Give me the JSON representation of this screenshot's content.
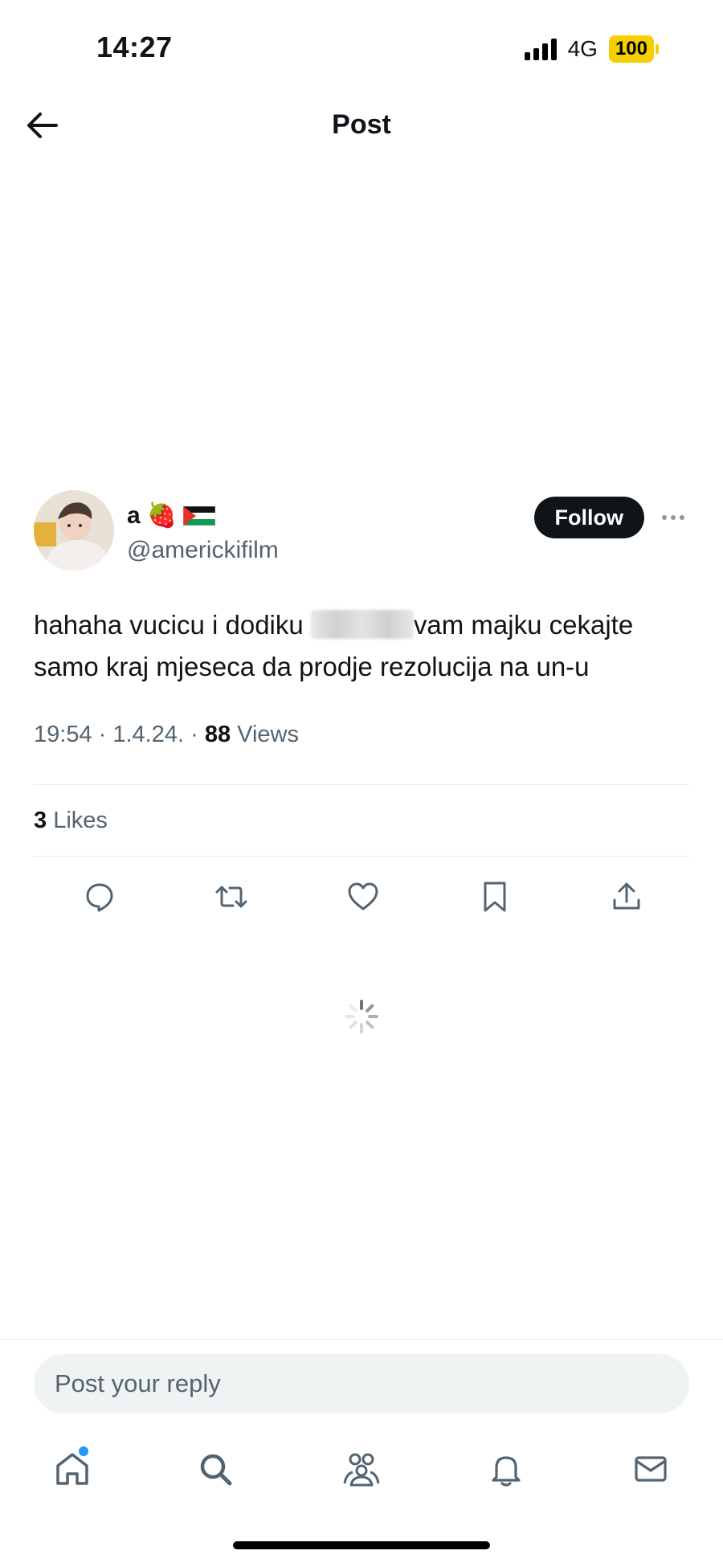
{
  "status_bar": {
    "time": "14:27",
    "network": "4G",
    "battery": "100"
  },
  "header": {
    "title": "Post"
  },
  "tweet": {
    "author_name": "a",
    "author_emojis": [
      "🍓"
    ],
    "handle": "@americkifilm",
    "follow_label": "Follow",
    "text_part1": "hahaha vucicu i dodiku ",
    "text_part2": "vam majku cekajte samo kraj mjeseca da prodje rezolucija na un-u",
    "time": "19:54",
    "date": "1.4.24.",
    "views_count": "88",
    "views_label": "Views",
    "likes_count": "3",
    "likes_label": "Likes"
  },
  "actions": [
    "reply-icon",
    "retweet-icon",
    "like-icon",
    "bookmark-icon",
    "share-icon"
  ],
  "reply": {
    "placeholder": "Post your reply"
  },
  "tabs": [
    "home-icon",
    "search-icon",
    "communities-icon",
    "notifications-icon",
    "messages-icon"
  ],
  "colors": {
    "follow_bg": "#0f1419",
    "secondary_text": "#536471",
    "accent": "#1d9bf0",
    "battery": "#f5d000"
  }
}
